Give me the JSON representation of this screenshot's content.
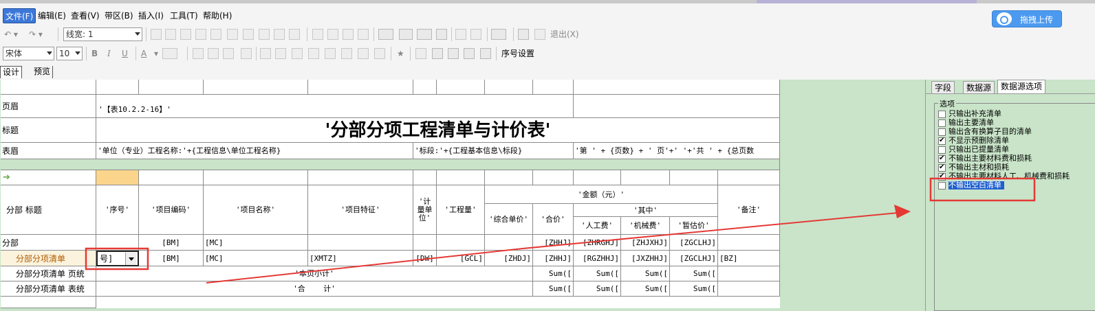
{
  "menubar": {
    "items": [
      "文件(F)",
      "编辑(E)",
      "查看(V)",
      "带区(B)",
      "插入(I)",
      "工具(T)",
      "帮助(H)"
    ]
  },
  "upload": {
    "label": "拖拽上传"
  },
  "toolbar1": {
    "line_width_label": "线宽: 1",
    "exit_label": "退出(X)"
  },
  "toolbar2": {
    "font_name": "宋体",
    "font_size": "10",
    "bold": "B",
    "italic": "I",
    "underline": "U",
    "font_color": "A",
    "serial_setting": "序号设置"
  },
  "design_tabs": [
    "设计",
    "预览"
  ],
  "grid": {
    "row_labels": {
      "page_header": "页眉",
      "title": "标题",
      "table_header": "表眉",
      "column_header": "分部 标题",
      "section": "分部",
      "item_list": "分部分项清单",
      "page_total": "分部分项清单 页统",
      "table_total": "分部分项清单 表统"
    },
    "page_header_text": "'【表10.2.2-16】'",
    "title_text": "'分部分项工程清单与计价表'",
    "table_header": {
      "unit": "'单位（专业）工程名称:'+{工程信息\\单位工程名称}",
      "section_no": "'标段:'+{工程基本信息\\标段}",
      "page": "'第 ' + {页数} + ' 页'+' '+'共 ' + {总页数"
    },
    "columns": {
      "serial": "'序号'",
      "code": "'项目编码'",
      "name": "'项目名称'",
      "feature": "'项目特征'",
      "unit": "'计量单位'",
      "qty": "'工程量'",
      "amount": "'金额（元）'",
      "unit_price": "'综合单价'",
      "total": "'合价'",
      "of_which": "'其中'",
      "labor": "'人工费'",
      "machine": "'机械费'",
      "provisional": "'暂估价'",
      "remark": "'备注'"
    },
    "section_row": {
      "code": "[BM]",
      "name": "[MC]",
      "total": "[ZHHJ]",
      "labor": "[ZHRGHJ]",
      "machine": "[ZHJXHJ]",
      "provisional": "[ZGCLHJ]"
    },
    "item_row": {
      "serial": "号]",
      "code": "[BM]",
      "name": "[MC]",
      "feature": "[XMTZ]",
      "unit": "[DW]",
      "qty": "[GCL]",
      "unit_price": "[ZHDJ]",
      "total": "[ZHHJ]",
      "labor": "[RGZHHJ]",
      "machine": "[JXZHHJ]",
      "provisional": "[ZGCLHJ]",
      "remark": "[BZ]"
    },
    "page_total_row": {
      "label": "'本页小计'",
      "total": "Sum([",
      "labor": "Sum([",
      "machine": "Sum([",
      "provisional": "Sum(["
    },
    "table_total_row": {
      "label": "'合    计'",
      "total": "Sum([",
      "labor": "Sum([",
      "machine": "Sum([",
      "provisional": "Sum(["
    }
  },
  "right_panel": {
    "tabs": [
      "字段",
      "数据源",
      "数据源选项"
    ],
    "legend": "选项",
    "options": [
      {
        "label": "只输出补充清单",
        "checked": false
      },
      {
        "label": "输出主要清单",
        "checked": false
      },
      {
        "label": "输出含有换算子目的清单",
        "checked": false
      },
      {
        "label": "不显示预删除清单",
        "checked": true
      },
      {
        "label": "只输出已提量清单",
        "checked": false
      },
      {
        "label": "不输出主要材料费和损耗",
        "checked": true
      },
      {
        "label": "不输出主材和损耗",
        "checked": true
      },
      {
        "label": "不输出主要材料人工、机械费和损耗",
        "checked": true
      },
      {
        "label": "不输出空白清单",
        "checked": false,
        "selected": true
      }
    ]
  },
  "colors": {
    "canvas": "#c9e4c9",
    "menu_active": "#3d78d8",
    "upload_button": "#4c9af0",
    "highlight_red": "#e53935",
    "selection": "#1f5fd0",
    "serial_col_header": "#fcd58c"
  }
}
